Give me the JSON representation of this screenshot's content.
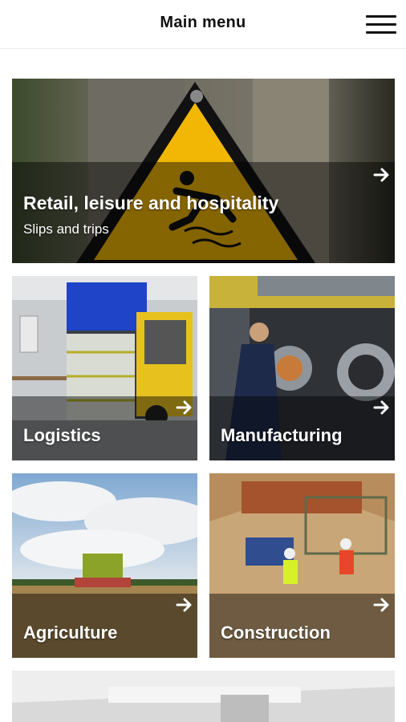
{
  "header": {
    "title": "Main menu",
    "menu_icon": "hamburger-menu-icon"
  },
  "tiles": [
    {
      "title": "Retail, leisure and hospitality",
      "subtitle": "Slips and trips",
      "icon": "arrow-right-icon"
    },
    {
      "title": "Logistics",
      "icon": "arrow-right-icon"
    },
    {
      "title": "Manufacturing",
      "icon": "arrow-right-icon"
    },
    {
      "title": "Agriculture",
      "icon": "arrow-right-icon"
    },
    {
      "title": "Construction",
      "icon": "arrow-right-icon"
    }
  ],
  "colors": {
    "header_bg": "#ffffff",
    "title_text": "#111111",
    "overlay": "rgba(0,0,0,0.45)",
    "tile_text": "#ffffff",
    "warning_yellow": "#f2b705"
  }
}
